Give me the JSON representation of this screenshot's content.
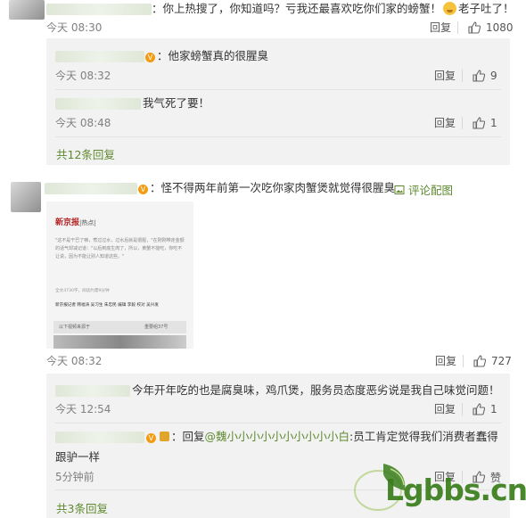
{
  "comments": [
    {
      "text_pre": "：你上热搜了，你知道吗？亏我还最喜欢吃你们家的螃蟹！",
      "text_post": "老子吐了！",
      "time": "今天 08:30",
      "reply": "回复",
      "likes": "1080",
      "replies": [
        {
          "text": "：他家螃蟹真的很腥臭",
          "time": "今天 08:32",
          "reply": "回复",
          "likes": "9"
        },
        {
          "text": "我气死了要！",
          "time": "今天 08:48",
          "reply": "回复",
          "likes": "1"
        }
      ],
      "more": "共12条回复"
    },
    {
      "text": "：怪不得两年前第一次吃你家肉蟹煲就觉得很腥臭",
      "comment_image_label": "评论配图",
      "time": "今天 08:32",
      "reply": "回复",
      "likes": "727",
      "replies": [
        {
          "text": "今年开年吃的也是腐臭味，鸡爪煲，服务员态度恶劣说是我自己味觉问题！",
          "time": "今天 12:54",
          "reply": "回复",
          "likes": "1"
        },
        {
          "reply_prefix": "：回复",
          "mention": "@魏小小小小小小小小小小白",
          "text_line1": ":员工肯定觉得我们消费者蠢得",
          "text_line2": "跟驴一样",
          "time": "5分钟前",
          "reply": "回复",
          "likes": "赞"
        }
      ],
      "more": "共3条回复"
    }
  ],
  "embedded_image": {
    "brand": "新京报",
    "tag": "|热点|",
    "paragraph": "\"这不是干巴了嘛，煮过过水，过水后就是很腥，\"在刚刚带走金额的话气却减记道：\"以后到底生肉了，所以，黄蟹不能吃，你吃不让说，因为不能让别人知道这些。\"",
    "meta": "全文4730字，阅读约需9分钟",
    "credits": "新京报记者 韩福涛 吴习生 朱忠民 编辑 李毅 校对 吴兴发",
    "footer_left": "以下视频来源于",
    "footer_right": "重要组37号"
  },
  "watermark": {
    "text": "Lgbbs.cn",
    "color": "#3a7d1c"
  },
  "colors": {
    "link": "#5e8a2e",
    "panel": "#f2f2f2",
    "muted": "#808080"
  }
}
